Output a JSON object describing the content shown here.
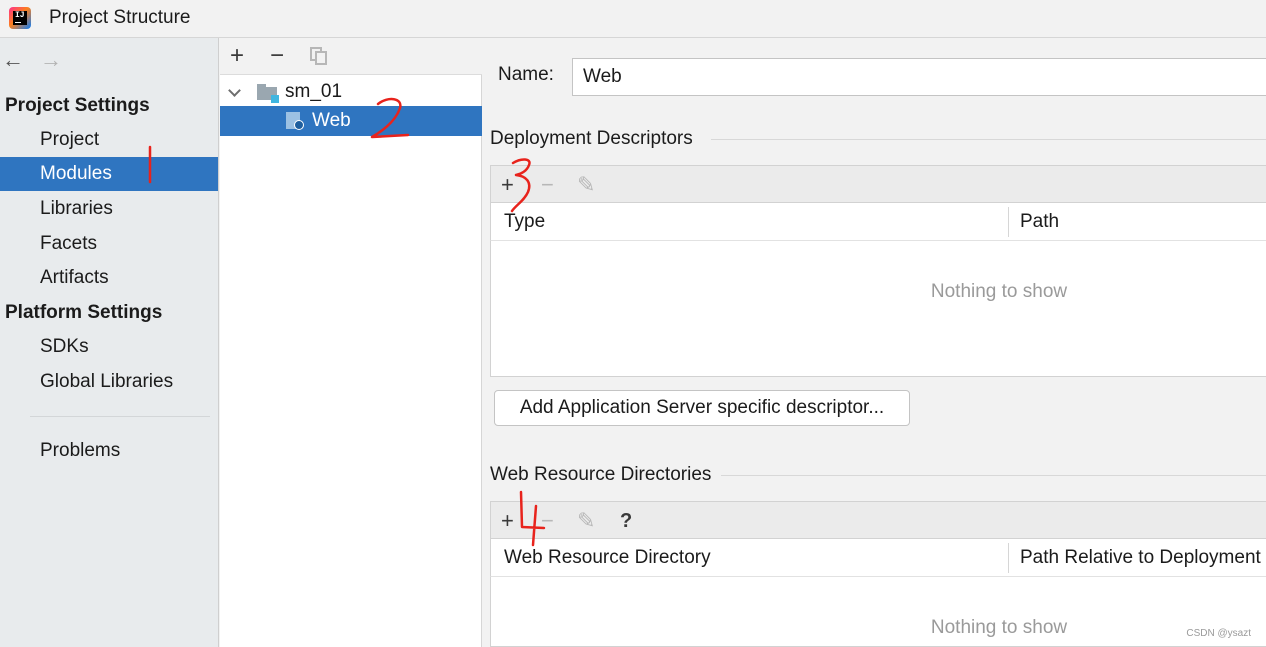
{
  "window": {
    "title": "Project Structure",
    "logo_text": "IJ"
  },
  "sidebar": {
    "back_icon": "arrow-left",
    "forward_icon": "arrow-right",
    "project_settings_header": "Project Settings",
    "platform_settings_header": "Platform Settings",
    "items": [
      {
        "label": "Project",
        "selected": false
      },
      {
        "label": "Modules",
        "selected": true
      },
      {
        "label": "Libraries",
        "selected": false
      },
      {
        "label": "Facets",
        "selected": false
      },
      {
        "label": "Artifacts",
        "selected": false
      },
      {
        "label": "SDKs",
        "selected": false
      },
      {
        "label": "Global Libraries",
        "selected": false
      },
      {
        "label": "Problems",
        "selected": false
      }
    ]
  },
  "tree": {
    "toolbar": {
      "add": "+",
      "remove": "−",
      "copy_icon": "copy"
    },
    "nodes": [
      {
        "label": "sm_01",
        "expanded": true,
        "icon": "module-folder"
      },
      {
        "label": "Web",
        "selected": true,
        "icon": "web-facet"
      }
    ]
  },
  "facet": {
    "name_label": "Name:",
    "name_value": "Web",
    "deployment": {
      "title": "Deployment Descriptors",
      "toolbar": {
        "add": "+",
        "remove": "−",
        "edit_icon": "pencil"
      },
      "columns": [
        "Type",
        "Path"
      ],
      "empty_text": "Nothing to show",
      "add_server_button": "Add Application Server specific descriptor..."
    },
    "web_resources": {
      "title": "Web Resource Directories",
      "toolbar": {
        "add": "+",
        "remove": "−",
        "edit_icon": "pencil",
        "help": "?"
      },
      "columns": [
        "Web Resource Directory",
        "Path Relative to Deployment"
      ],
      "empty_text": "Nothing to show"
    }
  },
  "annotations": {
    "color": "#e8231c",
    "marks": [
      "1",
      "2",
      "3",
      "4"
    ]
  },
  "watermark": "CSDN @ysazt"
}
